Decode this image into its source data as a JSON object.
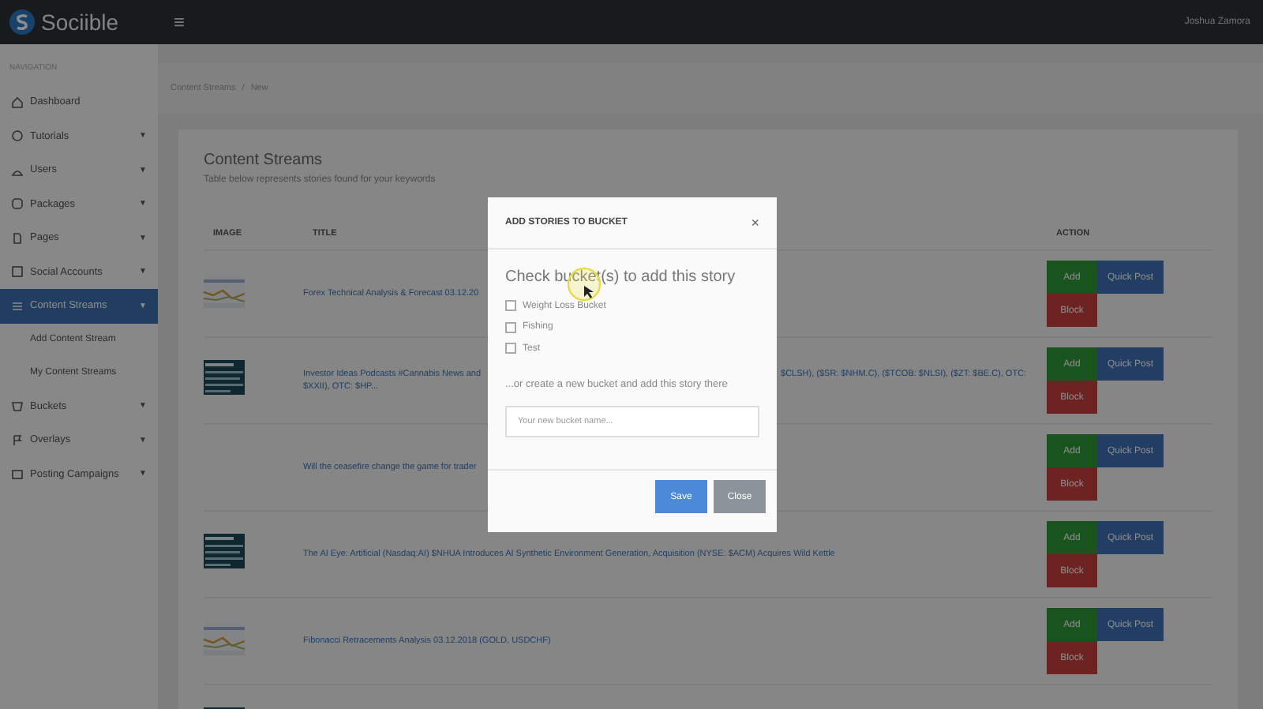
{
  "header": {
    "brand": "Sociible",
    "menu_glyph": "≡",
    "user": "Joshua Zamora"
  },
  "sidebar": {
    "section": "NAVIGATION",
    "items": [
      {
        "label": "Dashboard",
        "selected": false
      },
      {
        "label": "Tutorials",
        "caret": "▼",
        "selected": false
      },
      {
        "label": "Users",
        "caret": "▼",
        "selected": false
      },
      {
        "label": "Packages",
        "caret": "▼",
        "selected": false
      },
      {
        "label": "Pages",
        "caret": "▼",
        "selected": false
      },
      {
        "label": "Social Accounts",
        "caret": "▼",
        "selected": false
      },
      {
        "label": "Content Streams",
        "caret": "▼",
        "selected": true,
        "children": [
          {
            "label": "Add Content Stream"
          },
          {
            "label": "My Content Streams"
          }
        ]
      },
      {
        "label": "Buckets",
        "caret": "▼",
        "selected": false
      },
      {
        "label": "Overlays",
        "caret": "▼",
        "selected": false
      },
      {
        "label": "Posting Campaigns",
        "caret": "▼",
        "selected": false
      }
    ]
  },
  "breadcrumb": [
    "Content Streams",
    "/",
    "New"
  ],
  "page": {
    "title": "Content Streams",
    "subtitle": "Table below represents stories found for your keywords"
  },
  "table": {
    "columns": [
      "IMAGE",
      "TITLE",
      "ACTION"
    ],
    "rows": [
      {
        "image": {
          "kind": "picture"
        },
        "title_parts": [
          "Forex Technical Analysis & Forecast 03.12.20"
        ],
        "actions": [
          "Add",
          "Quick Post",
          "Block"
        ]
      },
      {
        "image": {
          "kind": "picture"
        },
        "title_parts": [
          "Investor Ideas Podcasts #Cannabis News and",
          "$CLSH), ($SR: $NHM.C), ($TCOB: $NLSI), ($ZT: $BE.C), OTC:",
          "$XXII), OTC: $HP..."
        ],
        "actions": [
          "Add",
          "Quick Post",
          "Block"
        ]
      },
      {
        "title_parts": [
          "Will the ceasefire change the game for trader"
        ],
        "actions": [
          "Add",
          "Quick Post",
          "Block"
        ]
      },
      {
        "image": {
          "kind": "picture"
        },
        "title_parts": [
          "The AI Eye: Artificial (Nasdaq:AI) $NHUA Introduces AI Synthetic Environment Generation, Acquisition (NYSE: $ACM) Acquires Wild Kettle"
        ],
        "actions": [
          "Add",
          "Quick Post",
          "Block"
        ]
      },
      {
        "image": {
          "kind": "picture"
        },
        "title_parts": [
          "Fibonacci Retracements Analysis 03.12.2018 (GOLD, USDCHF)"
        ],
        "actions": [
          "Add",
          "Quick Post",
          "Block"
        ]
      },
      {
        "image": {
          "kind": "picture"
        },
        "title_parts": [],
        "actions": []
      }
    ]
  },
  "modal": {
    "title": "ADD STORIES TO BUCKET",
    "close": "×",
    "heading": "Check bucket(s) to add this story",
    "buckets": [
      {
        "label": "Weight Loss Bucket",
        "checked": false
      },
      {
        "label": "Fishing",
        "checked": false
      },
      {
        "label": "Test",
        "checked": false
      }
    ],
    "create_text": "...or create a new bucket and add this story there",
    "input": {
      "placeholder": "Your new bucket name..."
    },
    "buttons": [
      {
        "label": "Save",
        "kind": "primary"
      },
      {
        "label": "Close",
        "kind": "secondary"
      }
    ]
  }
}
